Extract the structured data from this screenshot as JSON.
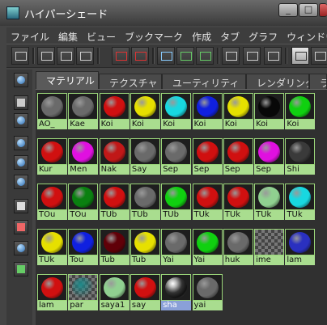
{
  "window": {
    "title": "ハイパーシェード"
  },
  "menu": [
    "ファイル",
    "編集",
    "ビュー",
    "ブックマーク",
    "作成",
    "タブ",
    "グラフ",
    "ウィンドウ"
  ],
  "tabs": [
    {
      "label": "マテリアル",
      "active": true
    },
    {
      "label": "テクスチャ",
      "active": false
    },
    {
      "label": "ユーティリティ",
      "active": false
    },
    {
      "label": "レンダリング",
      "active": false
    },
    {
      "label": "ラ",
      "active": false
    }
  ],
  "materials": [
    {
      "label": "AO_",
      "color": "#6a6a6a",
      "type": "ball"
    },
    {
      "label": "Kae",
      "color": "#6a6a6a",
      "type": "ball"
    },
    {
      "label": "Koi",
      "color": "#d01010",
      "type": "ball"
    },
    {
      "label": "Koi",
      "color": "#e6e000",
      "type": "ball"
    },
    {
      "label": "Koi",
      "color": "#18d8e0",
      "type": "ball"
    },
    {
      "label": "Koi",
      "color": "#1020e0",
      "type": "ball"
    },
    {
      "label": "Koi",
      "color": "#e6e000",
      "type": "ball"
    },
    {
      "label": "Koi",
      "color": "#080808",
      "type": "ball"
    },
    {
      "label": "Koi",
      "color": "#10d010",
      "type": "ball"
    },
    {
      "label": "Kur",
      "color": "#d01010",
      "type": "ball"
    },
    {
      "label": "Men",
      "color": "#e010e0",
      "type": "ball"
    },
    {
      "label": "Nak",
      "color": "#c01818",
      "type": "ball"
    },
    {
      "label": "Say",
      "color": "#6a6a6a",
      "type": "ball"
    },
    {
      "label": "Sep",
      "color": "#6a6a6a",
      "type": "ball"
    },
    {
      "label": "Sep",
      "color": "#d01010",
      "type": "ball"
    },
    {
      "label": "Sep",
      "color": "#d01010",
      "type": "ball"
    },
    {
      "label": "Sep",
      "color": "#e010e0",
      "type": "ball"
    },
    {
      "label": "Shi",
      "color": "#3a3a3a",
      "type": "ball"
    },
    {
      "label": "TOu",
      "color": "#d01010",
      "type": "ball"
    },
    {
      "label": "TOu",
      "color": "#0a8010",
      "type": "ball"
    },
    {
      "label": "TUb",
      "color": "#d01010",
      "type": "ball"
    },
    {
      "label": "TUb",
      "color": "#6a6a6a",
      "type": "ball"
    },
    {
      "label": "TUb",
      "color": "#10d010",
      "type": "ball"
    },
    {
      "label": "TUk",
      "color": "#d01010",
      "type": "ball"
    },
    {
      "label": "TUk",
      "color": "#d01010",
      "type": "ball"
    },
    {
      "label": "TUk",
      "color": "#90d090",
      "type": "ball"
    },
    {
      "label": "TUk",
      "color": "#18d8e0",
      "type": "ball"
    },
    {
      "label": "TUk",
      "color": "#e6e000",
      "type": "ball"
    },
    {
      "label": "Tou",
      "color": "#1020e0",
      "type": "ball"
    },
    {
      "label": "Tub",
      "color": "#600008",
      "type": "ball"
    },
    {
      "label": "Tub",
      "color": "#e6e000",
      "type": "ball"
    },
    {
      "label": "Yai",
      "color": "#6a6a6a",
      "type": "ball"
    },
    {
      "label": "Yai",
      "color": "#10d010",
      "type": "ball"
    },
    {
      "label": "huk",
      "color": "#6a6a6a",
      "type": "ball"
    },
    {
      "label": "ime",
      "color": "#777777",
      "type": "checker"
    },
    {
      "label": "lam",
      "color": "#2a30c0",
      "type": "ball"
    },
    {
      "label": "lam",
      "color": "#d01010",
      "type": "ball"
    },
    {
      "label": "par",
      "color": "#1e8a8a",
      "type": "checker"
    },
    {
      "label": "saya1",
      "color": "#90d090",
      "type": "ball"
    },
    {
      "label": "say",
      "color": "#d01010",
      "type": "ball"
    },
    {
      "label": "sha",
      "color": "#f0f0f0",
      "type": "chrome",
      "selected": true
    },
    {
      "label": "yai",
      "color": "#6a6a6a",
      "type": "ball"
    }
  ]
}
